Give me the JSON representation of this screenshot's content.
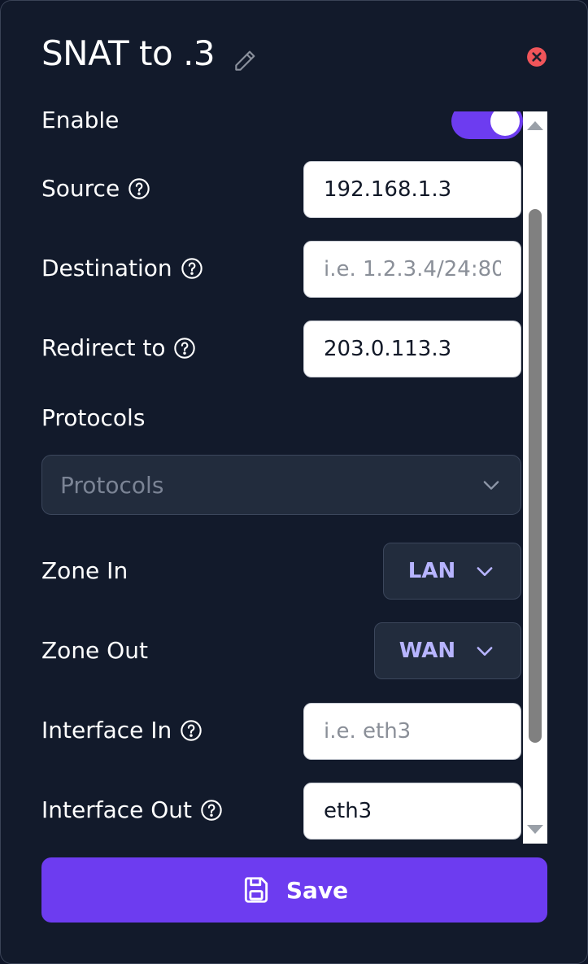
{
  "dialog": {
    "title": "SNAT to .3"
  },
  "form": {
    "enable_label": "Enable",
    "enable_on": true,
    "source": {
      "label": "Source",
      "value": "192.168.1.3",
      "placeholder": ""
    },
    "destination": {
      "label": "Destination",
      "value": "",
      "placeholder": "i.e. 1.2.3.4/24:80"
    },
    "redirect_to": {
      "label": "Redirect to",
      "value": "203.0.113.3",
      "placeholder": ""
    },
    "protocols": {
      "label": "Protocols",
      "placeholder": "Protocols"
    },
    "zone_in": {
      "label": "Zone In",
      "value": "LAN"
    },
    "zone_out": {
      "label": "Zone Out",
      "value": "WAN"
    },
    "interface_in": {
      "label": "Interface In",
      "value": "",
      "placeholder": "i.e. eth3"
    },
    "interface_out": {
      "label": "Interface Out",
      "value": "eth3",
      "placeholder": ""
    }
  },
  "actions": {
    "save_label": "Save"
  },
  "colors": {
    "accent": "#6d3cf0",
    "close": "#f0555a",
    "background": "#121a2b"
  },
  "icons": [
    "pencil-icon",
    "close-icon",
    "help-icon",
    "chevron-down-icon",
    "save-icon"
  ]
}
